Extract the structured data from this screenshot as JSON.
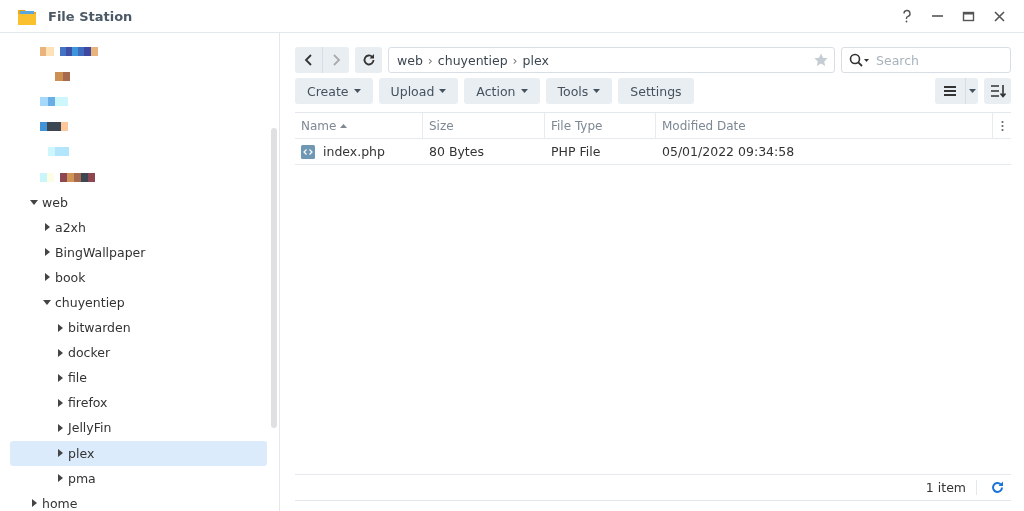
{
  "window": {
    "title": "File Station"
  },
  "tree": {
    "items": [
      {
        "kind": "redacted"
      },
      {
        "kind": "redacted"
      },
      {
        "kind": "redacted"
      },
      {
        "kind": "redacted"
      },
      {
        "kind": "redacted"
      },
      {
        "kind": "redacted"
      },
      {
        "kind": "folder",
        "label": "web",
        "expanded": true,
        "selected": false,
        "children": [
          {
            "kind": "folder",
            "label": "a2xh",
            "expanded": false,
            "selected": false
          },
          {
            "kind": "folder",
            "label": "BingWallpaper",
            "expanded": false,
            "selected": false
          },
          {
            "kind": "folder",
            "label": "book",
            "expanded": false,
            "selected": false
          },
          {
            "kind": "folder",
            "label": "chuyentiep",
            "expanded": true,
            "selected": false,
            "children": [
              {
                "kind": "folder",
                "label": "bitwarden",
                "expanded": false,
                "selected": false
              },
              {
                "kind": "folder",
                "label": "docker",
                "expanded": false,
                "selected": false
              },
              {
                "kind": "folder",
                "label": "file",
                "expanded": false,
                "selected": false
              },
              {
                "kind": "folder",
                "label": "firefox",
                "expanded": false,
                "selected": false
              },
              {
                "kind": "folder",
                "label": "JellyFin",
                "expanded": false,
                "selected": false
              },
              {
                "kind": "folder",
                "label": "plex",
                "expanded": false,
                "selected": true
              },
              {
                "kind": "folder",
                "label": "pma",
                "expanded": false,
                "selected": false
              }
            ]
          }
        ]
      },
      {
        "kind": "folder",
        "label": "home",
        "expanded": false,
        "selected": false
      }
    ]
  },
  "path": {
    "segments": [
      "web",
      "chuyentiep",
      "plex"
    ],
    "separator": "›"
  },
  "search": {
    "placeholder": "Search"
  },
  "toolbar": {
    "buttons": [
      {
        "label": "Create",
        "menu": true
      },
      {
        "label": "Upload",
        "menu": true
      },
      {
        "label": "Action",
        "menu": true
      },
      {
        "label": "Tools",
        "menu": true
      },
      {
        "label": "Settings",
        "menu": false
      }
    ]
  },
  "table": {
    "columns": [
      {
        "label": "Name",
        "sorted": true
      },
      {
        "label": "Size",
        "sorted": false
      },
      {
        "label": "File Type",
        "sorted": false
      },
      {
        "label": "Modified Date",
        "sorted": false
      }
    ],
    "rows": [
      {
        "kind": "code",
        "cells": [
          "index.php",
          "80 Bytes",
          "PHP File",
          "05/01/2022 09:34:58"
        ]
      }
    ]
  },
  "status_bar": {
    "count": "1 item"
  }
}
